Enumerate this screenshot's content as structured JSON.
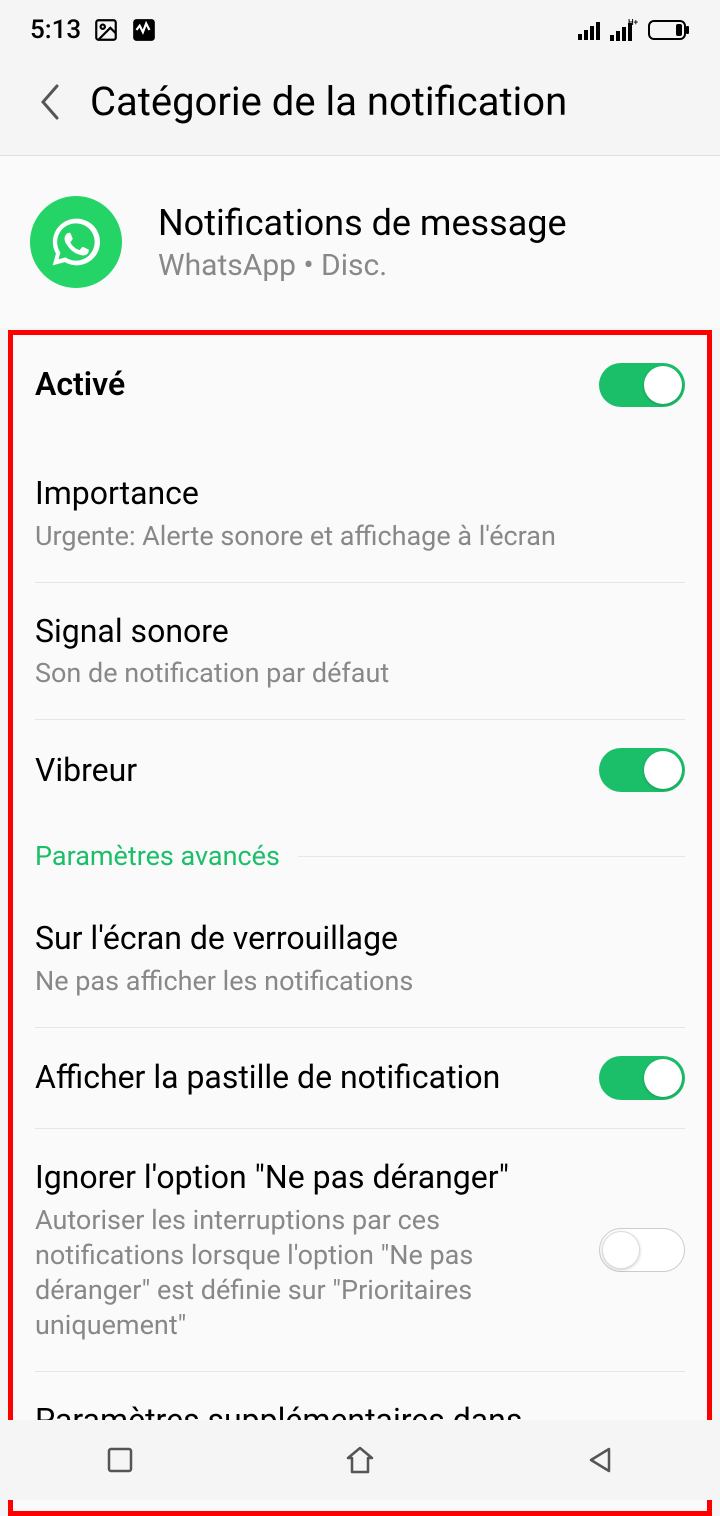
{
  "statusbar": {
    "time": "5:13"
  },
  "header": {
    "title": "Catégorie de la notification"
  },
  "app": {
    "title": "Notifications de message",
    "subtitle": "WhatsApp • Disc."
  },
  "settings": {
    "enabled_label": "Activé",
    "importance": {
      "title": "Importance",
      "sub": "Urgente: Alerte sonore et affichage à l'écran"
    },
    "sound": {
      "title": "Signal sonore",
      "sub": "Son de notification par défaut"
    },
    "vibrate": {
      "title": "Vibreur"
    },
    "advanced_header": "Paramètres avancés",
    "lockscreen": {
      "title": "Sur l'écran de verrouillage",
      "sub": "Ne pas afficher les notifications"
    },
    "badge": {
      "title": "Afficher la pastille de notification"
    },
    "dnd": {
      "title": "Ignorer l'option \"Ne pas déranger\"",
      "sub": "Autoriser les interruptions par ces notifications lorsque l'option \"Ne pas déranger\" est définie sur \"Prioritaires uniquement\""
    },
    "extra": {
      "title": "Paramètres supplémentaires dans l'application"
    }
  }
}
